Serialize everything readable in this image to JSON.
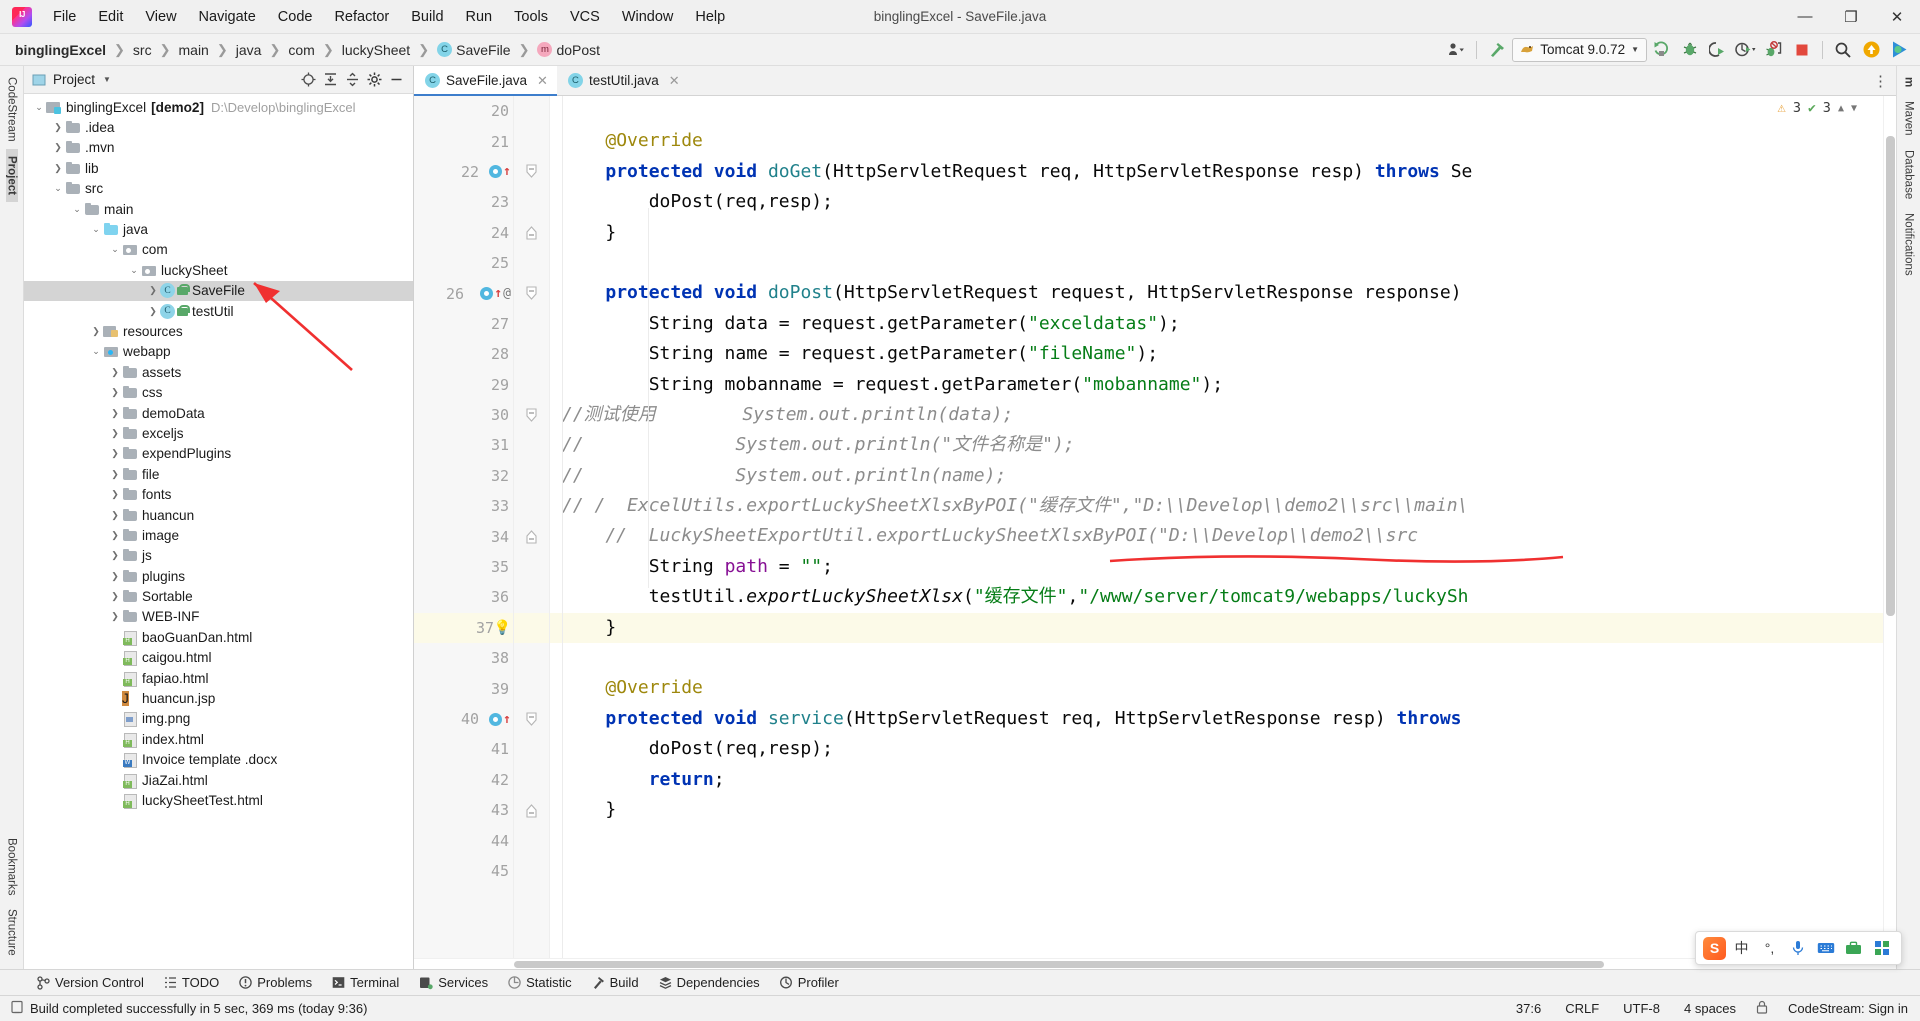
{
  "window": {
    "title": "binglingExcel - SaveFile.java",
    "controls": {
      "minimize": "—",
      "maximize": "❐",
      "close": "✕"
    }
  },
  "menu": [
    "File",
    "Edit",
    "View",
    "Navigate",
    "Code",
    "Refactor",
    "Build",
    "Run",
    "Tools",
    "VCS",
    "Window",
    "Help"
  ],
  "breadcrumb": [
    {
      "label": "binglingExcel",
      "bold": true,
      "badge": ""
    },
    {
      "label": "src",
      "bold": false,
      "badge": ""
    },
    {
      "label": "main",
      "bold": false,
      "badge": ""
    },
    {
      "label": "java",
      "bold": false,
      "badge": ""
    },
    {
      "label": "com",
      "bold": false,
      "badge": ""
    },
    {
      "label": "luckySheet",
      "bold": false,
      "badge": ""
    },
    {
      "label": "SaveFile",
      "bold": false,
      "badge": "C"
    },
    {
      "label": "doPost",
      "bold": false,
      "badge": "m"
    }
  ],
  "toolbar": {
    "run_config": "Tomcat 9.0.72",
    "icons": [
      "user-dropdown-icon",
      "build-hammer-icon",
      "run-icon",
      "debug-icon",
      "run-with-coverage-icon",
      "profile-icon",
      "attach-process-icon",
      "stop-icon",
      "search-everywhere-icon",
      "update-project-icon",
      "ide-assistant-icon"
    ]
  },
  "left_rail": [
    "CodeStream",
    "Project",
    "Bookmarks",
    "Structure"
  ],
  "right_rail": [
    "m",
    "Maven",
    "Database",
    "Notifications"
  ],
  "project_panel": {
    "title": "Project",
    "header_icons": [
      "locate-icon",
      "expand-all-icon",
      "collapse-all-icon",
      "settings-gear-icon",
      "hide-icon"
    ],
    "tree": [
      {
        "depth": 0,
        "label": "binglingExcel",
        "bold_suffix": "[demo2]",
        "location": "D:\\Develop\\binglingExcel",
        "icon": "module",
        "arrow": "down",
        "selected": false
      },
      {
        "depth": 1,
        "label": ".idea",
        "icon": "folder",
        "arrow": "right",
        "selected": false
      },
      {
        "depth": 1,
        "label": ".mvn",
        "icon": "folder",
        "arrow": "right",
        "selected": false
      },
      {
        "depth": 1,
        "label": "lib",
        "icon": "folder",
        "arrow": "right",
        "selected": false
      },
      {
        "depth": 1,
        "label": "src",
        "icon": "folder",
        "arrow": "down",
        "selected": false
      },
      {
        "depth": 2,
        "label": "main",
        "icon": "folder",
        "arrow": "down",
        "selected": false
      },
      {
        "depth": 3,
        "label": "java",
        "icon": "folder blue",
        "arrow": "down",
        "selected": false
      },
      {
        "depth": 4,
        "label": "com",
        "icon": "pkg",
        "arrow": "down",
        "selected": false
      },
      {
        "depth": 5,
        "label": "luckySheet",
        "icon": "pkg",
        "arrow": "down",
        "selected": false
      },
      {
        "depth": 6,
        "label": "SaveFile",
        "icon": "cls",
        "arrow": "right",
        "selected": true,
        "lock": true
      },
      {
        "depth": 6,
        "label": "testUtil",
        "icon": "cls",
        "arrow": "right",
        "selected": false,
        "lock": true
      },
      {
        "depth": 3,
        "label": "resources",
        "icon": "res",
        "arrow": "right",
        "selected": false
      },
      {
        "depth": 3,
        "label": "webapp",
        "icon": "webapp",
        "arrow": "down",
        "selected": false
      },
      {
        "depth": 4,
        "label": "assets",
        "icon": "folder",
        "arrow": "right",
        "selected": false
      },
      {
        "depth": 4,
        "label": "css",
        "icon": "folder",
        "arrow": "right",
        "selected": false
      },
      {
        "depth": 4,
        "label": "demoData",
        "icon": "folder",
        "arrow": "right",
        "selected": false
      },
      {
        "depth": 4,
        "label": "exceljs",
        "icon": "folder",
        "arrow": "right",
        "selected": false
      },
      {
        "depth": 4,
        "label": "expendPlugins",
        "icon": "folder",
        "arrow": "right",
        "selected": false
      },
      {
        "depth": 4,
        "label": "file",
        "icon": "folder",
        "arrow": "right",
        "selected": false
      },
      {
        "depth": 4,
        "label": "fonts",
        "icon": "folder",
        "arrow": "right",
        "selected": false
      },
      {
        "depth": 4,
        "label": "huancun",
        "icon": "folder",
        "arrow": "right",
        "selected": false
      },
      {
        "depth": 4,
        "label": "image",
        "icon": "folder",
        "arrow": "right",
        "selected": false
      },
      {
        "depth": 4,
        "label": "js",
        "icon": "folder",
        "arrow": "right",
        "selected": false
      },
      {
        "depth": 4,
        "label": "plugins",
        "icon": "folder",
        "arrow": "right",
        "selected": false
      },
      {
        "depth": 4,
        "label": "Sortable",
        "icon": "folder",
        "arrow": "right",
        "selected": false
      },
      {
        "depth": 4,
        "label": "WEB-INF",
        "icon": "folder",
        "arrow": "right",
        "selected": false
      },
      {
        "depth": 4,
        "label": "baoGuanDan.html",
        "icon": "html",
        "arrow": "none",
        "selected": false
      },
      {
        "depth": 4,
        "label": "caigou.html",
        "icon": "html",
        "arrow": "none",
        "selected": false
      },
      {
        "depth": 4,
        "label": "fapiao.html",
        "icon": "html",
        "arrow": "none",
        "selected": false
      },
      {
        "depth": 4,
        "label": "huancun.jsp",
        "icon": "jsp",
        "arrow": "none",
        "selected": false
      },
      {
        "depth": 4,
        "label": "img.png",
        "icon": "png",
        "arrow": "none",
        "selected": false
      },
      {
        "depth": 4,
        "label": "index.html",
        "icon": "html",
        "arrow": "none",
        "selected": false
      },
      {
        "depth": 4,
        "label": "Invoice template .docx",
        "icon": "docx",
        "arrow": "none",
        "selected": false
      },
      {
        "depth": 4,
        "label": "JiaZai.html",
        "icon": "html",
        "arrow": "none",
        "selected": false
      },
      {
        "depth": 4,
        "label": "luckySheetTest.html",
        "icon": "html",
        "arrow": "none",
        "selected": false
      }
    ]
  },
  "editor": {
    "tabs": [
      {
        "label": "SaveFile.java",
        "active": true,
        "badge": "C"
      },
      {
        "label": "testUtil.java",
        "active": false,
        "badge": "C"
      }
    ],
    "inspection": {
      "warnings": "3",
      "checks": "3"
    },
    "first_line_number": 20,
    "current_line": 37,
    "lines": [
      {
        "n": 20,
        "tokens": []
      },
      {
        "n": 21,
        "tokens": [
          {
            "t": "    ",
            "c": ""
          },
          {
            "t": "@Override",
            "c": "ann"
          }
        ]
      },
      {
        "n": 22,
        "marks": [
          "override",
          "uparrow"
        ],
        "fold": "start",
        "tokens": [
          {
            "t": "    ",
            "c": ""
          },
          {
            "t": "protected",
            "c": "kw"
          },
          {
            "t": " ",
            "c": ""
          },
          {
            "t": "void",
            "c": "kw"
          },
          {
            "t": " ",
            "c": ""
          },
          {
            "t": "doGet",
            "c": "typ"
          },
          {
            "t": "(HttpServletRequest req, HttpServletResponse resp) ",
            "c": ""
          },
          {
            "t": "throws",
            "c": "kw"
          },
          {
            "t": " Se",
            "c": ""
          }
        ]
      },
      {
        "n": 23,
        "tokens": [
          {
            "t": "        doPost(req,resp);",
            "c": ""
          }
        ]
      },
      {
        "n": 24,
        "fold": "end",
        "tokens": [
          {
            "t": "    }",
            "c": ""
          }
        ]
      },
      {
        "n": 25,
        "tokens": []
      },
      {
        "n": 26,
        "marks": [
          "override",
          "uparrow",
          "at"
        ],
        "fold": "start",
        "tokens": [
          {
            "t": "    ",
            "c": ""
          },
          {
            "t": "protected",
            "c": "kw"
          },
          {
            "t": " ",
            "c": ""
          },
          {
            "t": "void",
            "c": "kw"
          },
          {
            "t": " ",
            "c": ""
          },
          {
            "t": "doPost",
            "c": "typ"
          },
          {
            "t": "(HttpServletRequest request, HttpServletResponse response)",
            "c": ""
          }
        ]
      },
      {
        "n": 27,
        "tokens": [
          {
            "t": "        String data = request.getParameter(",
            "c": ""
          },
          {
            "t": "\"exceldatas\"",
            "c": "str"
          },
          {
            "t": ");",
            "c": ""
          }
        ]
      },
      {
        "n": 28,
        "tokens": [
          {
            "t": "        String name = request.getParameter(",
            "c": ""
          },
          {
            "t": "\"fileName\"",
            "c": "str"
          },
          {
            "t": ");",
            "c": ""
          }
        ]
      },
      {
        "n": 29,
        "tokens": [
          {
            "t": "        String mobanname = request.getParameter(",
            "c": ""
          },
          {
            "t": "\"mobanname\"",
            "c": "str"
          },
          {
            "t": ");",
            "c": ""
          }
        ]
      },
      {
        "n": 30,
        "fold": "start",
        "tokens": [
          {
            "t": "//测试使用        System.out.println(data);",
            "c": "cmt"
          }
        ]
      },
      {
        "n": 31,
        "tokens": [
          {
            "t": "//              System.out.println(\"文件名称是\");",
            "c": "cmt"
          }
        ]
      },
      {
        "n": 32,
        "tokens": [
          {
            "t": "//              System.out.println(name);",
            "c": "cmt"
          }
        ]
      },
      {
        "n": 33,
        "tokens": [
          {
            "t": "// /  ExcelUtils.exportLuckySheetXlsxByPOI(\"缓存文件\",\"D:\\\\Develop\\\\demo2\\\\src\\\\main\\",
            "c": "cmt"
          }
        ]
      },
      {
        "n": 34,
        "fold": "end",
        "tokens": [
          {
            "t": "    //  LuckySheetExportUtil.exportLuckySheetXlsxByPOI(\"D:\\\\Develop\\\\demo2\\\\src",
            "c": "cmt"
          }
        ]
      },
      {
        "n": 35,
        "tokens": [
          {
            "t": "        String ",
            "c": ""
          },
          {
            "t": "path",
            "c": "fld"
          },
          {
            "t": " = ",
            "c": ""
          },
          {
            "t": "\"\"",
            "c": "str"
          },
          {
            "t": ";",
            "c": ""
          }
        ]
      },
      {
        "n": 36,
        "tokens": [
          {
            "t": "        testUtil.",
            "c": ""
          },
          {
            "t": "exportLuckySheetXlsx",
            "c": "mth"
          },
          {
            "t": "(",
            "c": ""
          },
          {
            "t": "\"缓存文件\"",
            "c": "str"
          },
          {
            "t": ",",
            "c": ""
          },
          {
            "t": "\"/www/server/tomcat9/webapps/luckySh",
            "c": "str"
          }
        ]
      },
      {
        "n": 37,
        "marks": [
          "bulb"
        ],
        "current": true,
        "tokens": [
          {
            "t": "    }",
            "c": ""
          }
        ]
      },
      {
        "n": 38,
        "tokens": []
      },
      {
        "n": 39,
        "tokens": [
          {
            "t": "    ",
            "c": ""
          },
          {
            "t": "@Override",
            "c": "ann"
          }
        ]
      },
      {
        "n": 40,
        "marks": [
          "override",
          "uparrow"
        ],
        "fold": "start",
        "tokens": [
          {
            "t": "    ",
            "c": ""
          },
          {
            "t": "protected",
            "c": "kw"
          },
          {
            "t": " ",
            "c": ""
          },
          {
            "t": "void",
            "c": "kw"
          },
          {
            "t": " ",
            "c": ""
          },
          {
            "t": "service",
            "c": "typ"
          },
          {
            "t": "(HttpServletRequest req, HttpServletResponse resp) ",
            "c": ""
          },
          {
            "t": "throws",
            "c": "kw"
          }
        ]
      },
      {
        "n": 41,
        "tokens": [
          {
            "t": "        doPost(req,resp);",
            "c": ""
          }
        ]
      },
      {
        "n": 42,
        "tokens": [
          {
            "t": "        ",
            "c": ""
          },
          {
            "t": "return",
            "c": "kw"
          },
          {
            "t": ";",
            "c": ""
          }
        ]
      },
      {
        "n": 43,
        "fold": "end",
        "tokens": [
          {
            "t": "    }",
            "c": ""
          }
        ]
      },
      {
        "n": 44,
        "tokens": []
      },
      {
        "n": 45,
        "tokens": []
      }
    ]
  },
  "tool_windows": [
    {
      "label": "Version Control",
      "icon": "branch-icon"
    },
    {
      "label": "TODO",
      "icon": "todo-list-icon"
    },
    {
      "label": "Problems",
      "icon": "problems-icon"
    },
    {
      "label": "Terminal",
      "icon": "terminal-icon"
    },
    {
      "label": "Services",
      "icon": "services-icon"
    },
    {
      "label": "Statistic",
      "icon": "statistic-icon"
    },
    {
      "label": "Build",
      "icon": "build-hammer-icon"
    },
    {
      "label": "Dependencies",
      "icon": "dependencies-icon"
    },
    {
      "label": "Profiler",
      "icon": "profiler-icon"
    }
  ],
  "status_bar": {
    "message": "Build completed successfully in 5 sec, 369 ms (today 9:36)",
    "caret": "37:6",
    "line_separator": "CRLF",
    "encoding": "UTF-8",
    "indent": "4 spaces",
    "branch": "CodeStream: Sign in"
  },
  "ime": {
    "logo": "S",
    "items": [
      "中",
      "°,",
      "mic-icon",
      "keyboard-icon",
      "toolbox-icon",
      "apps-icon"
    ]
  },
  "colors": {
    "accent": "#3d7ecc",
    "keyword": "#0033b3",
    "string": "#067d17",
    "comment": "#8c8c8c",
    "annotation": "#9e880d",
    "type": "#20818b",
    "selection": "#d4d4d4",
    "current_line": "#fcfae8",
    "annotation_red": "#f03030"
  }
}
